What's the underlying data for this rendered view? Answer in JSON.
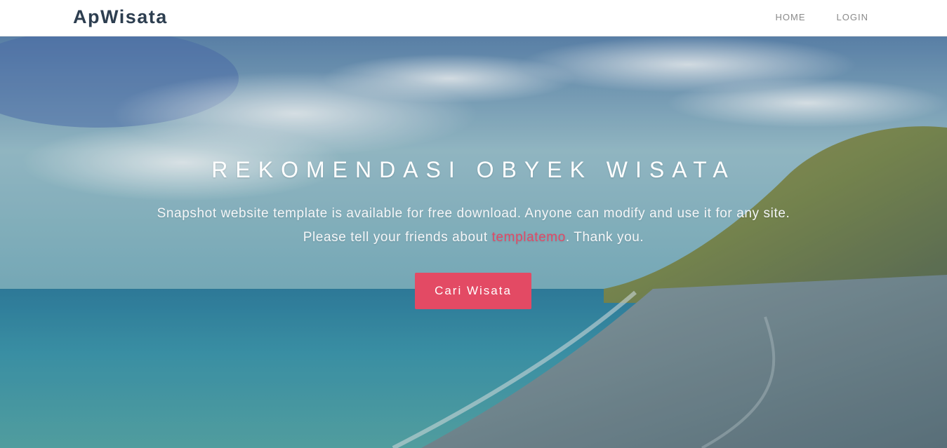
{
  "navbar": {
    "brand": "ApWisata",
    "links": [
      "HOME",
      "LOGIN"
    ]
  },
  "hero": {
    "title": "REKOMENDASI OBYEK WISATA",
    "desc_line1": "Snapshot website template is available for free download. Anyone can modify and use it for any site.",
    "desc_line2_before": "Please tell your friends about ",
    "desc_link": "templatemo",
    "desc_line2_after": ". Thank you.",
    "cta_label": "Cari Wisata"
  },
  "colors": {
    "brand_text": "#2d3e50",
    "accent": "#e34a64",
    "nav_text": "#8a8a8a"
  }
}
